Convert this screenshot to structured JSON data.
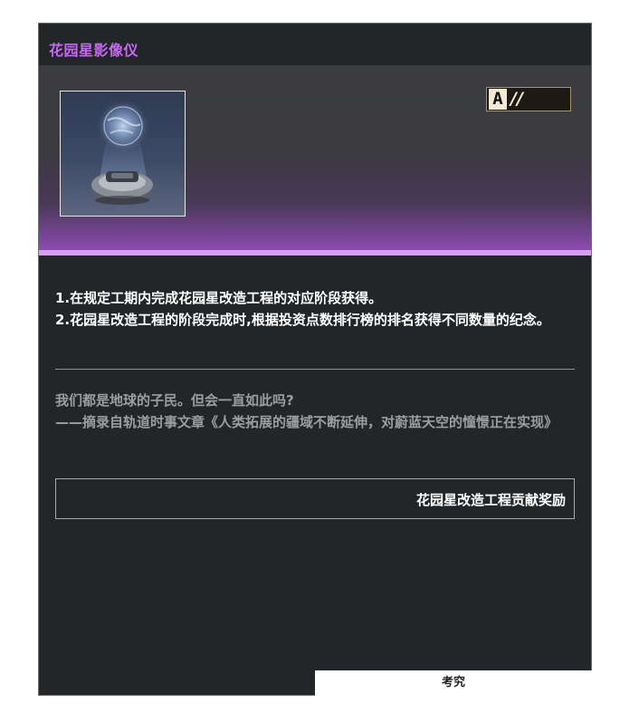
{
  "item": {
    "title": "花园星影像仪",
    "rank_letter": "A",
    "rank_mark": "//",
    "description": [
      "1.在规定工期内完成花园星改造工程的对应阶段获得。",
      "2.花园星改造工程的阶段完成时,根据投资点数排行榜的排名获得不同数量的纪念。"
    ],
    "quote": [
      "我们都是地球的子民。但会一直如此吗?",
      "——摘录自轨道时事文章《人类拓展的疆域不断延伸，对蔚蓝天空的憧憬正在实现》"
    ],
    "reward_label": "花园星改造工程贡献奖励",
    "bottom_tab_label": "考究"
  },
  "colors": {
    "title_accent": "#c668f2",
    "card_background": "#232628",
    "banner_glow": "#8c4bb0",
    "rank_border": "#a5946a"
  },
  "icons": {
    "item_image": "hologram-projector-image"
  }
}
